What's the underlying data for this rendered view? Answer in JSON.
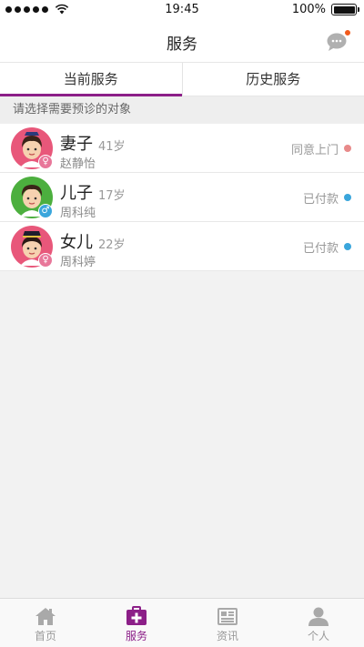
{
  "status_bar": {
    "time": "19:45",
    "battery": "100%",
    "battery_level": 1.0
  },
  "nav": {
    "title": "服务",
    "chat_icon": "chat-bubble-icon",
    "notification_color": "#f25a1c"
  },
  "tabs": [
    {
      "label": "当前服务",
      "active": true
    },
    {
      "label": "历史服务",
      "active": false
    }
  ],
  "section_label": "请选择需要预诊的对象",
  "patients": [
    {
      "name": "妻子",
      "age": "41岁",
      "realname": "赵静怡",
      "status": "同意上门",
      "status_color": "#e88a8a",
      "gender": "♀",
      "gender_color": "#e8779a",
      "avatar_bg": "#e8577a"
    },
    {
      "name": "儿子",
      "age": "17岁",
      "realname": "周科纯",
      "status": "已付款",
      "status_color": "#3aa6dc",
      "gender": "♂",
      "gender_color": "#3aa6dc",
      "avatar_bg": "#4caf3e"
    },
    {
      "name": "女儿",
      "age": "22岁",
      "realname": "周科婷",
      "status": "已付款",
      "status_color": "#3aa6dc",
      "gender": "♀",
      "gender_color": "#e8779a",
      "avatar_bg": "#e8577a"
    }
  ],
  "tabbar": [
    {
      "label": "首页",
      "icon": "home-icon",
      "active": false
    },
    {
      "label": "服务",
      "icon": "medical-kit-icon",
      "active": true
    },
    {
      "label": "资讯",
      "icon": "news-icon",
      "active": false
    },
    {
      "label": "个人",
      "icon": "person-icon",
      "active": false
    }
  ],
  "accent_color": "#8c1f88"
}
